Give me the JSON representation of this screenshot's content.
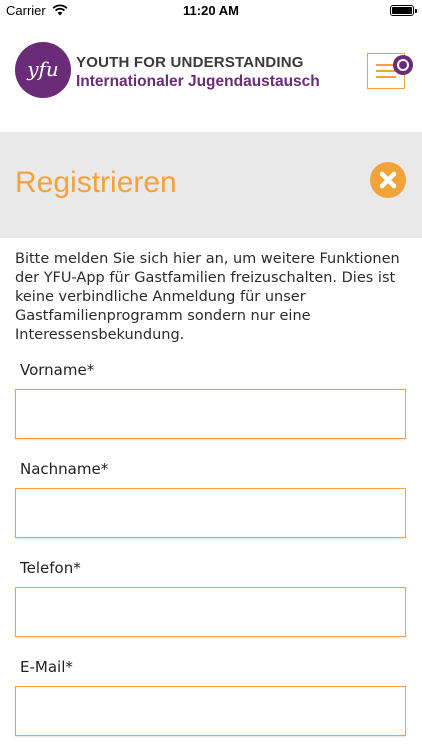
{
  "status_bar": {
    "carrier": "Carrier",
    "time": "11:20 AM",
    "wifi_icon": "wifi-icon",
    "battery_icon": "battery-icon"
  },
  "header": {
    "logo_text": "yfu",
    "title": "YOUTH FOR UNDERSTANDING",
    "subtitle": "Internationaler Jugendaustausch",
    "menu_icon": "hamburger-menu-icon"
  },
  "page": {
    "title": "Registrieren",
    "close_icon": "close-icon"
  },
  "intro": "Bitte melden Sie sich hier an, um weitere Funktionen der YFU-App für Gastfamilien freizuschalten. Dies ist keine verbindliche Anmeldung für unser Gastfamilienprogramm sondern nur eine Interessensbekundung.",
  "form": {
    "fields": [
      {
        "label": "Vorname*",
        "value": "",
        "placeholder": ""
      },
      {
        "label": "Nachname*",
        "value": "",
        "placeholder": ""
      },
      {
        "label": "Telefon*",
        "value": "",
        "placeholder": ""
      },
      {
        "label": "E-Mail*",
        "value": "",
        "placeholder": ""
      }
    ]
  },
  "colors": {
    "accent": "#f2a33a",
    "brand_purple": "#6a2c78",
    "title_band": "#e9e9e9"
  }
}
